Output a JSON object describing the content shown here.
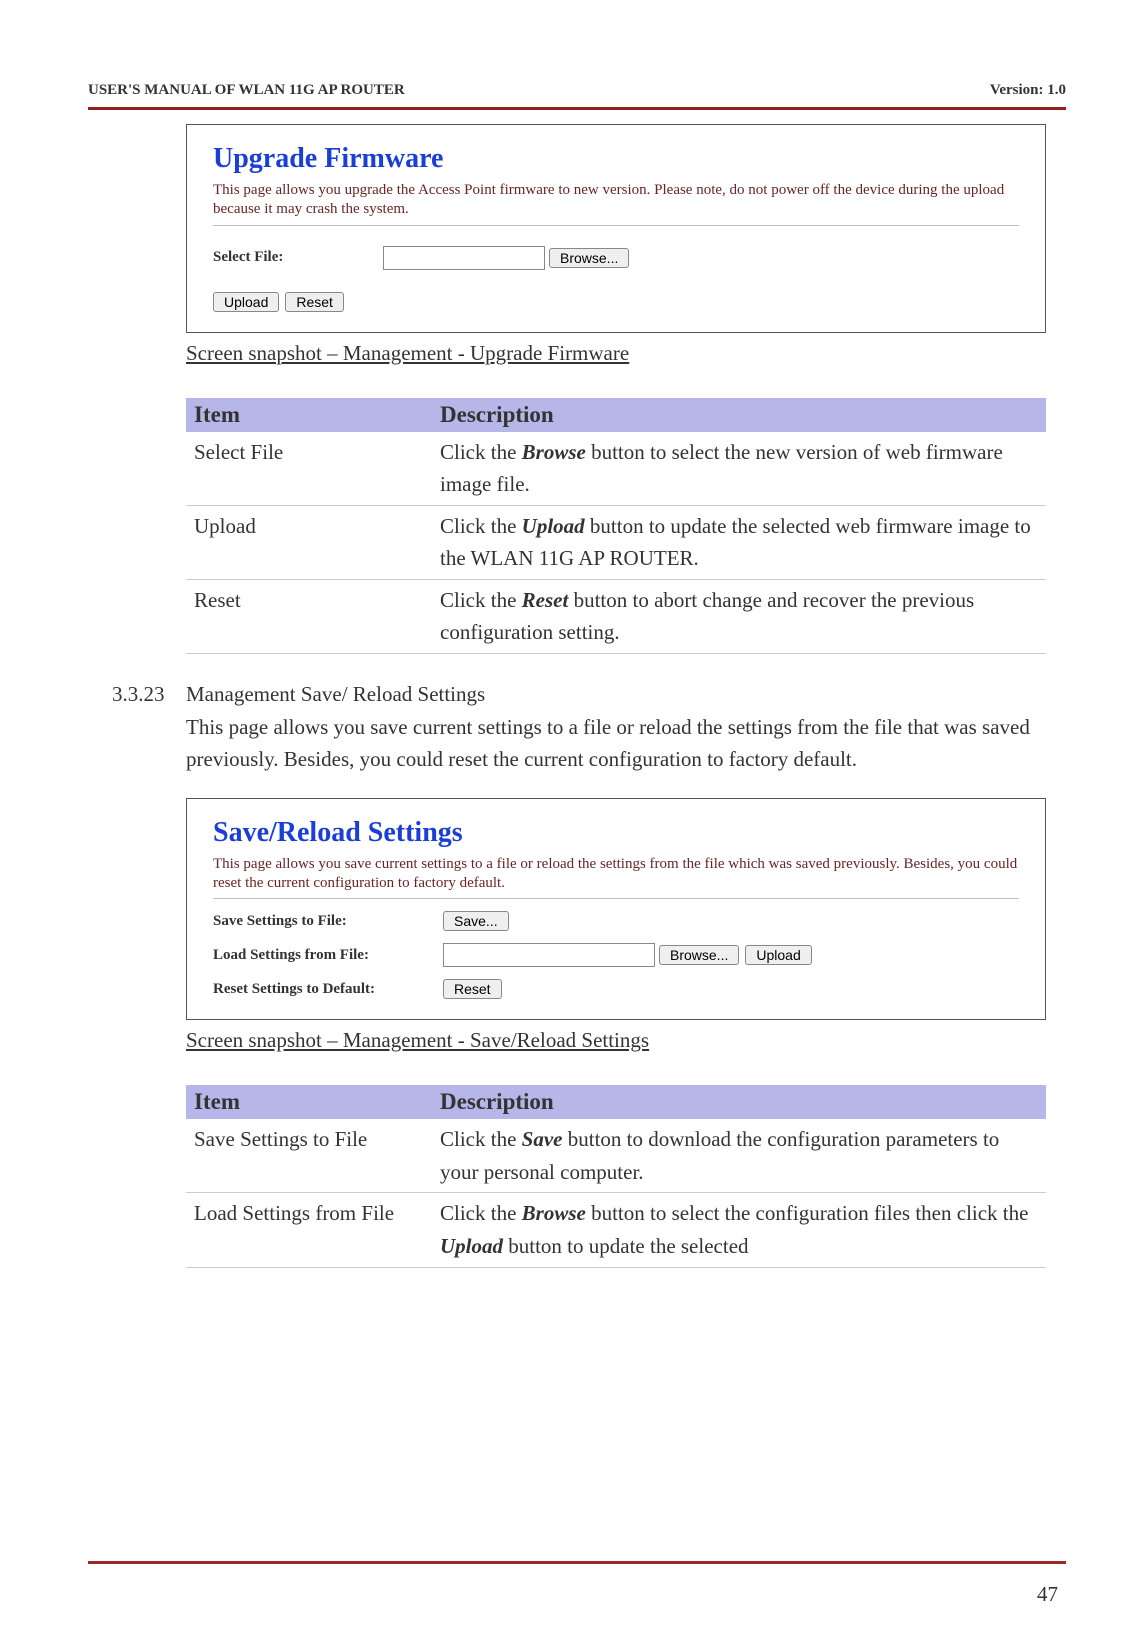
{
  "header": {
    "left": "USER'S MANUAL OF WLAN 11G AP ROUTER",
    "right": "Version: 1.0"
  },
  "panel1": {
    "title": "Upgrade Firmware",
    "desc": "This page allows you upgrade the Access Point firmware to new version. Please note, do not power off the device during the upload because it may crash the system.",
    "selectLabel": "Select File:",
    "browseBtn": "Browse...",
    "uploadBtn": "Upload",
    "resetBtn": "Reset"
  },
  "caption1": "Screen snapshot – Management - Upgrade Firmware",
  "table1": {
    "head": {
      "c1": "Item",
      "c2": "Description"
    },
    "rows": [
      {
        "item": "Select File",
        "desc_pre": "Click the ",
        "bold": "Browse",
        "desc_post": " button to select the new version of web firmware image file."
      },
      {
        "item": "Upload",
        "desc_pre": "Click the ",
        "bold": "Upload",
        "desc_post": " button to update the selected web firmware image to the WLAN 11G AP ROUTER."
      },
      {
        "item": "Reset",
        "desc_pre": "Click the ",
        "bold": "Reset",
        "desc_post": " button to abort change and recover the previous configuration setting."
      }
    ]
  },
  "section": {
    "num": "3.3.23",
    "title": "Management Save/ Reload Settings",
    "body": "This page allows you save current settings to a file or reload the settings from the file that was saved previously. Besides, you could reset the current configuration to factory default."
  },
  "panel2": {
    "title": "Save/Reload Settings",
    "desc": "This page allows you save current settings to a file or reload the settings from the file which was saved previously. Besides, you could reset the current configuration to factory default.",
    "saveLabel": "Save Settings to File:",
    "saveBtn": "Save...",
    "loadLabel": "Load Settings from File:",
    "browseBtn": "Browse...",
    "uploadBtn": "Upload",
    "resetLabel": "Reset Settings to Default:",
    "resetBtn": "Reset"
  },
  "caption2": "Screen snapshot – Management - Save/Reload Settings",
  "table2": {
    "head": {
      "c1": "Item",
      "c2": "Description"
    },
    "rows": [
      {
        "item": "Save Settings to File",
        "desc_pre": "Click the ",
        "bold": "Save",
        "desc_post": " button to download the configuration parameters to your personal computer."
      },
      {
        "item": "Load Settings from File",
        "desc_pre": "Click the ",
        "bold": "Browse",
        "desc_mid": " button to select the configuration files then click the ",
        "bold2": "Upload",
        "desc_post": " button to update the selected"
      }
    ]
  },
  "pagenum": "47"
}
